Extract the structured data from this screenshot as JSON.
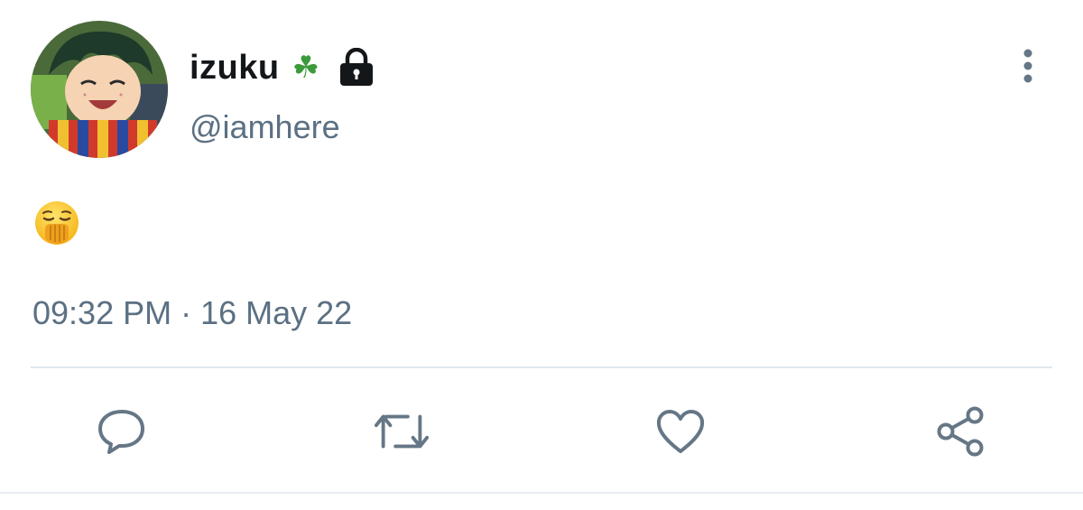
{
  "author": {
    "display_name": "izuku",
    "name_emoji": "☘",
    "protected_icon": "lock-icon",
    "handle": "@iamhere"
  },
  "tweet": {
    "text_emoji": "yawning-face-emoji",
    "time": "09:32 PM",
    "separator": "·",
    "date": "16 May 22"
  },
  "actions": [
    {
      "name": "reply",
      "icon": "comment-bubble-icon"
    },
    {
      "name": "retweet",
      "icon": "retweet-icon"
    },
    {
      "name": "like",
      "icon": "heart-icon"
    },
    {
      "name": "share",
      "icon": "share-icon"
    }
  ],
  "colors": {
    "text_primary": "#14171a",
    "text_secondary": "#5b7083",
    "icon_gray": "#657786",
    "divider": "#e1e8ed",
    "clover_green": "#3a9b3a"
  }
}
